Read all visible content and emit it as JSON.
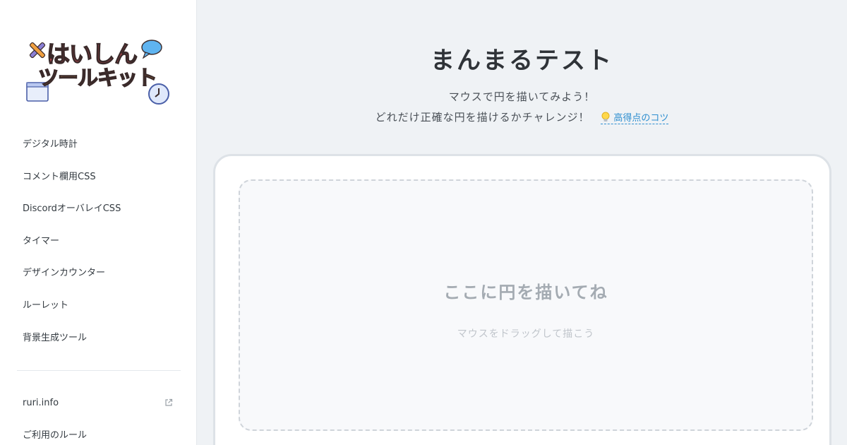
{
  "logo": {
    "line1": "はいしん",
    "line2": "ツールキット"
  },
  "nav": {
    "items": [
      {
        "label": "デジタル時計"
      },
      {
        "label": "コメント欄用CSS"
      },
      {
        "label": "DiscordオーバレイCSS"
      },
      {
        "label": "タイマー"
      },
      {
        "label": "デザインカウンター"
      },
      {
        "label": "ルーレット"
      },
      {
        "label": "背景生成ツール"
      }
    ],
    "external": [
      {
        "label": "ruri.info",
        "icon": "external-link-icon"
      },
      {
        "label": "ご利用のルール"
      }
    ]
  },
  "main": {
    "title": "まんまるテスト",
    "subtitle_line1": "マウスで円を描いてみよう！",
    "subtitle_line2": "どれだけ正確な円を描けるかチャレンジ！",
    "tips_label": "高得点のコツ",
    "tips_icon": "lightbulb-icon"
  },
  "canvas": {
    "title": "ここに円を描いてね",
    "hint": "マウスをドラッグして描こう"
  },
  "colors": {
    "accent": "#2f8fd0",
    "background": "#eff2f5",
    "sidebar": "#ffffff",
    "logo_red": "#e0505a",
    "logo_orange": "#f0a040"
  }
}
